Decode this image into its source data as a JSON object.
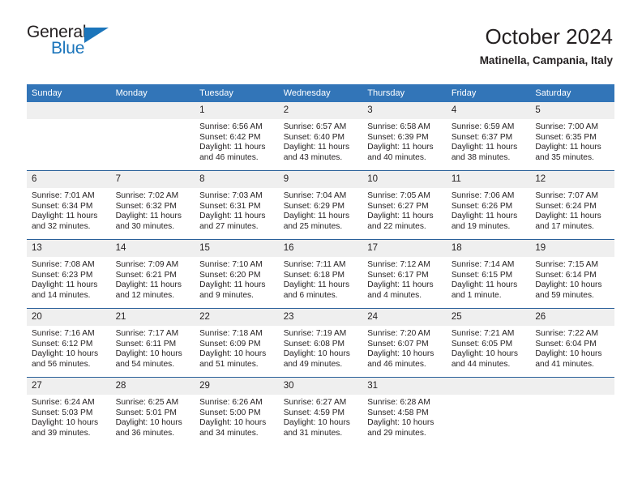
{
  "logo": {
    "word_one": "General",
    "word_two": "Blue",
    "triangle_icon": "triangle-icon",
    "brand_color": "#1b75bb"
  },
  "header": {
    "title": "October 2024",
    "subtitle": "Matinella, Campania, Italy"
  },
  "theme": {
    "header_blue": "#3275b8",
    "separator_blue": "#2a6099",
    "daynum_band": "#efefef"
  },
  "weekday_headers": [
    "Sunday",
    "Monday",
    "Tuesday",
    "Wednesday",
    "Thursday",
    "Friday",
    "Saturday"
  ],
  "weeks": [
    [
      {
        "day": "",
        "sunrise": "",
        "sunset": "",
        "daylight_line1": "",
        "daylight_line2": ""
      },
      {
        "day": "",
        "sunrise": "",
        "sunset": "",
        "daylight_line1": "",
        "daylight_line2": ""
      },
      {
        "day": "1",
        "sunrise": "Sunrise: 6:56 AM",
        "sunset": "Sunset: 6:42 PM",
        "daylight_line1": "Daylight: 11 hours",
        "daylight_line2": "and 46 minutes."
      },
      {
        "day": "2",
        "sunrise": "Sunrise: 6:57 AM",
        "sunset": "Sunset: 6:40 PM",
        "daylight_line1": "Daylight: 11 hours",
        "daylight_line2": "and 43 minutes."
      },
      {
        "day": "3",
        "sunrise": "Sunrise: 6:58 AM",
        "sunset": "Sunset: 6:39 PM",
        "daylight_line1": "Daylight: 11 hours",
        "daylight_line2": "and 40 minutes."
      },
      {
        "day": "4",
        "sunrise": "Sunrise: 6:59 AM",
        "sunset": "Sunset: 6:37 PM",
        "daylight_line1": "Daylight: 11 hours",
        "daylight_line2": "and 38 minutes."
      },
      {
        "day": "5",
        "sunrise": "Sunrise: 7:00 AM",
        "sunset": "Sunset: 6:35 PM",
        "daylight_line1": "Daylight: 11 hours",
        "daylight_line2": "and 35 minutes."
      }
    ],
    [
      {
        "day": "6",
        "sunrise": "Sunrise: 7:01 AM",
        "sunset": "Sunset: 6:34 PM",
        "daylight_line1": "Daylight: 11 hours",
        "daylight_line2": "and 32 minutes."
      },
      {
        "day": "7",
        "sunrise": "Sunrise: 7:02 AM",
        "sunset": "Sunset: 6:32 PM",
        "daylight_line1": "Daylight: 11 hours",
        "daylight_line2": "and 30 minutes."
      },
      {
        "day": "8",
        "sunrise": "Sunrise: 7:03 AM",
        "sunset": "Sunset: 6:31 PM",
        "daylight_line1": "Daylight: 11 hours",
        "daylight_line2": "and 27 minutes."
      },
      {
        "day": "9",
        "sunrise": "Sunrise: 7:04 AM",
        "sunset": "Sunset: 6:29 PM",
        "daylight_line1": "Daylight: 11 hours",
        "daylight_line2": "and 25 minutes."
      },
      {
        "day": "10",
        "sunrise": "Sunrise: 7:05 AM",
        "sunset": "Sunset: 6:27 PM",
        "daylight_line1": "Daylight: 11 hours",
        "daylight_line2": "and 22 minutes."
      },
      {
        "day": "11",
        "sunrise": "Sunrise: 7:06 AM",
        "sunset": "Sunset: 6:26 PM",
        "daylight_line1": "Daylight: 11 hours",
        "daylight_line2": "and 19 minutes."
      },
      {
        "day": "12",
        "sunrise": "Sunrise: 7:07 AM",
        "sunset": "Sunset: 6:24 PM",
        "daylight_line1": "Daylight: 11 hours",
        "daylight_line2": "and 17 minutes."
      }
    ],
    [
      {
        "day": "13",
        "sunrise": "Sunrise: 7:08 AM",
        "sunset": "Sunset: 6:23 PM",
        "daylight_line1": "Daylight: 11 hours",
        "daylight_line2": "and 14 minutes."
      },
      {
        "day": "14",
        "sunrise": "Sunrise: 7:09 AM",
        "sunset": "Sunset: 6:21 PM",
        "daylight_line1": "Daylight: 11 hours",
        "daylight_line2": "and 12 minutes."
      },
      {
        "day": "15",
        "sunrise": "Sunrise: 7:10 AM",
        "sunset": "Sunset: 6:20 PM",
        "daylight_line1": "Daylight: 11 hours",
        "daylight_line2": "and 9 minutes."
      },
      {
        "day": "16",
        "sunrise": "Sunrise: 7:11 AM",
        "sunset": "Sunset: 6:18 PM",
        "daylight_line1": "Daylight: 11 hours",
        "daylight_line2": "and 6 minutes."
      },
      {
        "day": "17",
        "sunrise": "Sunrise: 7:12 AM",
        "sunset": "Sunset: 6:17 PM",
        "daylight_line1": "Daylight: 11 hours",
        "daylight_line2": "and 4 minutes."
      },
      {
        "day": "18",
        "sunrise": "Sunrise: 7:14 AM",
        "sunset": "Sunset: 6:15 PM",
        "daylight_line1": "Daylight: 11 hours",
        "daylight_line2": "and 1 minute."
      },
      {
        "day": "19",
        "sunrise": "Sunrise: 7:15 AM",
        "sunset": "Sunset: 6:14 PM",
        "daylight_line1": "Daylight: 10 hours",
        "daylight_line2": "and 59 minutes."
      }
    ],
    [
      {
        "day": "20",
        "sunrise": "Sunrise: 7:16 AM",
        "sunset": "Sunset: 6:12 PM",
        "daylight_line1": "Daylight: 10 hours",
        "daylight_line2": "and 56 minutes."
      },
      {
        "day": "21",
        "sunrise": "Sunrise: 7:17 AM",
        "sunset": "Sunset: 6:11 PM",
        "daylight_line1": "Daylight: 10 hours",
        "daylight_line2": "and 54 minutes."
      },
      {
        "day": "22",
        "sunrise": "Sunrise: 7:18 AM",
        "sunset": "Sunset: 6:09 PM",
        "daylight_line1": "Daylight: 10 hours",
        "daylight_line2": "and 51 minutes."
      },
      {
        "day": "23",
        "sunrise": "Sunrise: 7:19 AM",
        "sunset": "Sunset: 6:08 PM",
        "daylight_line1": "Daylight: 10 hours",
        "daylight_line2": "and 49 minutes."
      },
      {
        "day": "24",
        "sunrise": "Sunrise: 7:20 AM",
        "sunset": "Sunset: 6:07 PM",
        "daylight_line1": "Daylight: 10 hours",
        "daylight_line2": "and 46 minutes."
      },
      {
        "day": "25",
        "sunrise": "Sunrise: 7:21 AM",
        "sunset": "Sunset: 6:05 PM",
        "daylight_line1": "Daylight: 10 hours",
        "daylight_line2": "and 44 minutes."
      },
      {
        "day": "26",
        "sunrise": "Sunrise: 7:22 AM",
        "sunset": "Sunset: 6:04 PM",
        "daylight_line1": "Daylight: 10 hours",
        "daylight_line2": "and 41 minutes."
      }
    ],
    [
      {
        "day": "27",
        "sunrise": "Sunrise: 6:24 AM",
        "sunset": "Sunset: 5:03 PM",
        "daylight_line1": "Daylight: 10 hours",
        "daylight_line2": "and 39 minutes."
      },
      {
        "day": "28",
        "sunrise": "Sunrise: 6:25 AM",
        "sunset": "Sunset: 5:01 PM",
        "daylight_line1": "Daylight: 10 hours",
        "daylight_line2": "and 36 minutes."
      },
      {
        "day": "29",
        "sunrise": "Sunrise: 6:26 AM",
        "sunset": "Sunset: 5:00 PM",
        "daylight_line1": "Daylight: 10 hours",
        "daylight_line2": "and 34 minutes."
      },
      {
        "day": "30",
        "sunrise": "Sunrise: 6:27 AM",
        "sunset": "Sunset: 4:59 PM",
        "daylight_line1": "Daylight: 10 hours",
        "daylight_line2": "and 31 minutes."
      },
      {
        "day": "31",
        "sunrise": "Sunrise: 6:28 AM",
        "sunset": "Sunset: 4:58 PM",
        "daylight_line1": "Daylight: 10 hours",
        "daylight_line2": "and 29 minutes."
      },
      {
        "day": "",
        "sunrise": "",
        "sunset": "",
        "daylight_line1": "",
        "daylight_line2": ""
      },
      {
        "day": "",
        "sunrise": "",
        "sunset": "",
        "daylight_line1": "",
        "daylight_line2": ""
      }
    ]
  ]
}
